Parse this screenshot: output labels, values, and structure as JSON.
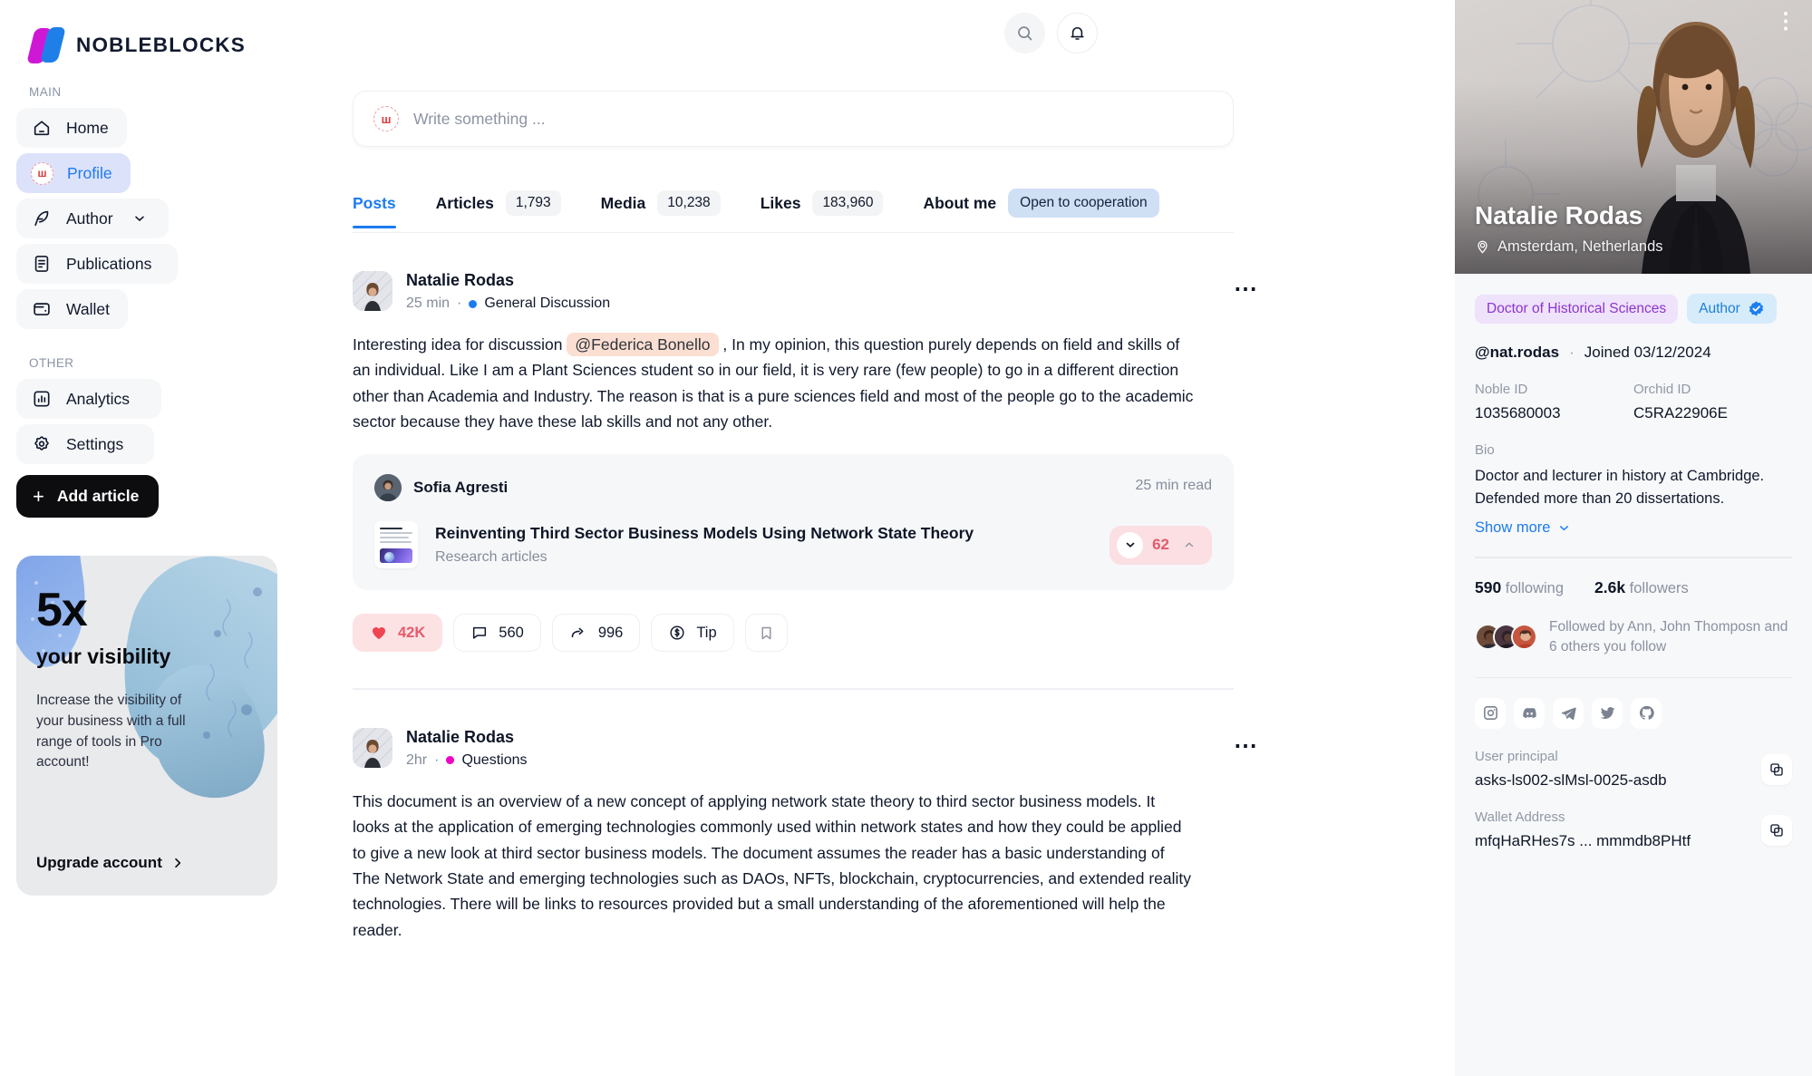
{
  "brand": {
    "name": "NOBLEBLOCKS",
    "logo_icon": "nobleblocks-logo-icon"
  },
  "header": {
    "search_icon": "search-icon",
    "bell_icon": "bell-icon"
  },
  "sidebar": {
    "groups": [
      {
        "label": "MAIN",
        "items": [
          {
            "label": "Home",
            "icon": "home-icon",
            "active": false
          },
          {
            "label": "Profile",
            "icon": "profile-avatar-icon",
            "active": true
          },
          {
            "label": "Author",
            "icon": "feather-pen-icon",
            "active": false,
            "chevron": "chevron-down-icon"
          },
          {
            "label": "Publications",
            "icon": "document-icon",
            "active": false
          },
          {
            "label": "Wallet",
            "icon": "wallet-icon",
            "active": false
          }
        ]
      },
      {
        "label": "OTHER",
        "items": [
          {
            "label": "Analytics",
            "icon": "bar-chart-icon",
            "active": false
          },
          {
            "label": "Settings",
            "icon": "gear-icon",
            "active": false
          }
        ]
      }
    ],
    "add_article": {
      "label": "Add article",
      "icon": "plus-icon"
    },
    "promo": {
      "headline": "5x",
      "subhead": "your visibility",
      "text": "Increase the visibility of your business with a full range of tools in Pro account!",
      "cta": "Upgrade account",
      "cta_icon": "chevron-right-icon"
    }
  },
  "composer": {
    "placeholder": "Write something ...",
    "avatar_initial": "ш"
  },
  "tabs": [
    {
      "label": "Posts",
      "count": null,
      "active": true
    },
    {
      "label": "Articles",
      "count": "1,793",
      "active": false
    },
    {
      "label": "Media",
      "count": "10,238",
      "active": false
    },
    {
      "label": "Likes",
      "count": "183,960",
      "active": false
    },
    {
      "label": "About me",
      "pill": "Open to cooperation",
      "active": false
    }
  ],
  "posts": [
    {
      "author": "Natalie Rodas",
      "time": "25 min",
      "category": "General Discussion",
      "category_color": "#1c7bf0",
      "body_before": "Interesting idea for discussion",
      "mention": "@Federica Bonello",
      "body_after": ", In my opinion, this question purely depends on field and skills of an individual. Like I am a Plant Sciences student so in our field, it is very rare (few people) to go in a different direction other than Academia and Industry. The reason is that is a pure sciences field and most of the people go to the academic sector because they have these lab skills and not any other.",
      "embed": {
        "author": "Sofia Agresti",
        "read_time": "25 min read",
        "title": "Reinventing Third Sector Business Models Using Network State Theory",
        "subtitle": "Research articles",
        "votes": "62",
        "vote_down_icon": "chevron-down-icon",
        "vote_up_icon": "chevron-up-icon"
      },
      "actions": {
        "like": "42K",
        "comment": "560",
        "share": "996",
        "tip": "Tip",
        "bookmark_icon": "bookmark-icon"
      },
      "more_icon": "more-horizontal-icon"
    },
    {
      "author": "Natalie Rodas",
      "time": "2hr",
      "category": "Questions",
      "category_color": "#ef00c8",
      "body": "This document is an overview of a new concept of applying network state theory to third sector business models. It looks at the application of emerging technologies commonly used within network states and how they could be applied to give a new look at third sector business models. The document assumes the reader has a basic understanding of The Network State and emerging technologies such as DAOs, NFTs, blockchain, cryptocurrencies, and extended reality technologies. There will be links to resources provided but a small understanding of the aforementioned will help the reader.",
      "more_icon": "more-horizontal-icon"
    }
  ],
  "profile": {
    "name": "Natalie Rodas",
    "location": "Amsterdam, Netherlands",
    "location_icon": "map-pin-icon",
    "menu_icon": "more-vertical-icon",
    "badges": [
      {
        "label": "Doctor of Historical Sciences",
        "style": "purple"
      },
      {
        "label": "Author",
        "style": "blue",
        "icon": "verified-badge-icon"
      }
    ],
    "handle": "@nat.rodas",
    "separator": "·",
    "joined": "Joined 03/12/2024",
    "noble_id_label": "Noble ID",
    "noble_id_value": "1035680003",
    "orchid_id_label": "Orchid ID",
    "orchid_id_value": "C5RA22906E",
    "bio_label": "Bio",
    "bio_text": "Doctor and lecturer in history at Cambridge. Defended more than 20 dissertations.",
    "show_more": "Show more",
    "show_more_icon": "chevron-down-icon",
    "following_count": "590",
    "following_label": "following",
    "followers_count": "2.6k",
    "followers_label": "followers",
    "followed_by": "Followed by Ann, John Thomposn and 6 others you follow",
    "socials": [
      {
        "name": "instagram-icon"
      },
      {
        "name": "discord-icon"
      },
      {
        "name": "telegram-icon"
      },
      {
        "name": "twitter-icon"
      },
      {
        "name": "github-icon"
      }
    ],
    "user_principal_label": "User principal",
    "user_principal_value": "asks-ls002-slMsl-0025-asdb",
    "wallet_label": "Wallet Address",
    "wallet_value": "mfqHaRHes7s ... mmmdb8PHtf",
    "copy_icon": "copy-icon"
  },
  "colors": {
    "accent_blue": "#1c7bf0",
    "magenta": "#ef00c8",
    "like_pink": "#e85a6a",
    "logo_magenta": "#cf18d6",
    "logo_blue": "#1f7fe8"
  }
}
